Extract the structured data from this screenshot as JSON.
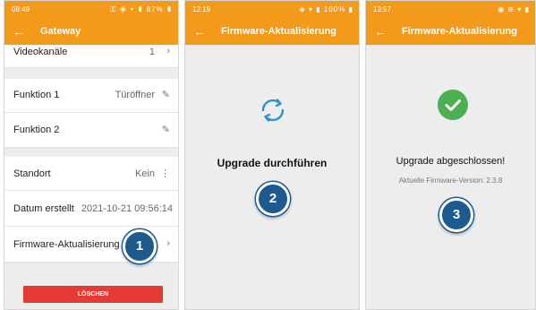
{
  "screen1": {
    "status_time": "08:49",
    "status_icons": "⚿ ◈ ▾ ▮ 87% ▮",
    "back_icon": "←",
    "title": "Gateway",
    "rows": [
      {
        "label": "Videokanäle",
        "value": "1",
        "icon": "chevron-right-icon"
      },
      {
        "label": "Funktion 1",
        "value": "Türöffner",
        "icon": "edit-icon"
      },
      {
        "label": "Funktion 2",
        "value": "",
        "icon": "edit-icon"
      },
      {
        "label": "Standort",
        "value": "Kein",
        "icon": "more-vert-icon"
      },
      {
        "label": "Datum erstellt",
        "value": "2021-10-21 09:56:14",
        "icon": ""
      },
      {
        "label": "Firmware-Aktualisierung",
        "value": "",
        "icon": "chevron-right-icon"
      }
    ],
    "delete_label": "LÖSCHEN",
    "step": "1"
  },
  "screen2": {
    "status_time": "12:19",
    "status_icons": "◈ ▾ ▮ 100% ▮",
    "back_icon": "←",
    "title": "Firmware-Aktualisierung",
    "message": "Upgrade durchführen",
    "step": "2"
  },
  "screen3": {
    "status_time": "13:57",
    "status_icons": "◉ ⊝ ▾ ▮",
    "back_icon": "←",
    "title": "Firmware-Aktualisierung",
    "message": "Upgrade abgeschlossen!",
    "version": "Aktuelle Firmware-Version: 2.3.8",
    "step": "3"
  },
  "colors": {
    "accent": "#f39a1a",
    "delete": "#e63b34",
    "badge": "#1d5b8e",
    "success": "#4caf50",
    "sync": "#2e8fd0"
  }
}
